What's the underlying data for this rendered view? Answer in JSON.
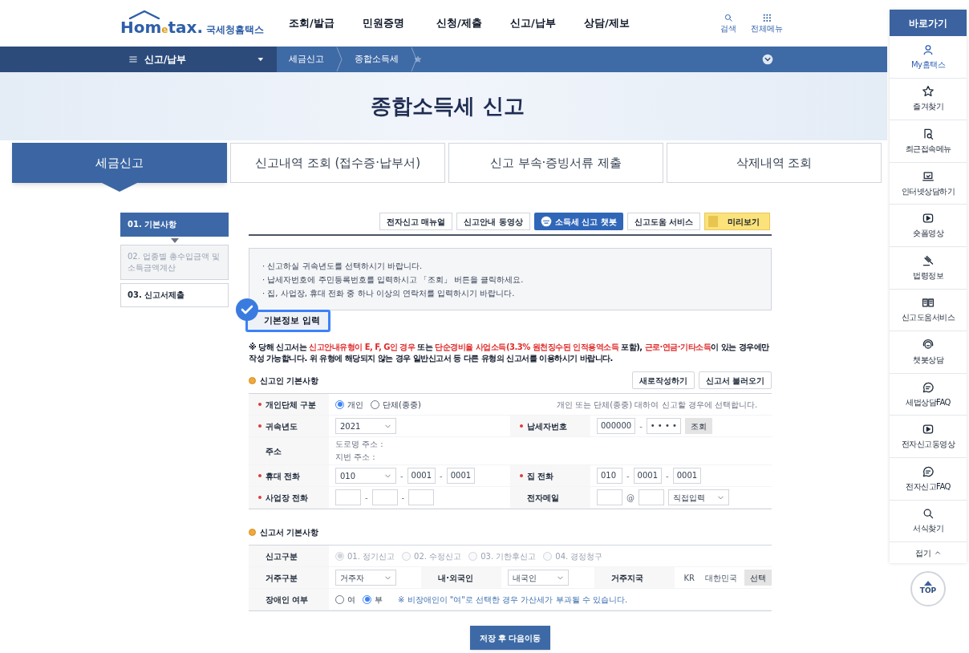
{
  "header": {
    "logo": {
      "parts": [
        "Hom",
        "e",
        "tax."
      ],
      "subtitle": "국세청홈택스"
    },
    "nav": [
      "조회/발급",
      "민원증명",
      "신청/제출",
      "신고/납부",
      "상담/제보"
    ],
    "tools": [
      {
        "label": "검색"
      },
      {
        "label": "전체메뉴"
      }
    ]
  },
  "breadcrumb": {
    "menu": "신고/납부",
    "items": [
      "세금신고",
      "종합소득세"
    ]
  },
  "page_title": "종합소득세 신고",
  "tabs": [
    {
      "label": "세금신고",
      "selected": true
    },
    {
      "label": "신고내역 조회 (접수증·납부서)",
      "selected": false
    },
    {
      "label": "신고 부속·증빙서류 제출",
      "selected": false
    },
    {
      "label": "삭제내역 조회",
      "selected": false
    }
  ],
  "steps": [
    {
      "label": "01. 기본사항",
      "selected": true,
      "disabled": false
    },
    {
      "label": "02. 업종별 총수입금액 및 소득금액계산",
      "selected": false,
      "disabled": true
    },
    {
      "label": "03. 신고서제출",
      "selected": false,
      "disabled": false
    }
  ],
  "toolbar": [
    {
      "label": "전자신고 매뉴얼",
      "kind": "plain"
    },
    {
      "label": "신고안내 동영상",
      "kind": "plain"
    },
    {
      "label": "소득세 신고 챗봇",
      "kind": "chatbot"
    },
    {
      "label": "신고도움 서비스",
      "kind": "plain"
    },
    {
      "label": "미리보기",
      "kind": "preview"
    }
  ],
  "notices": [
    "· 신고하실 귀속년도를 선택하시기 바랍니다.",
    "· 납세자번호에 주민등록번호를 입력하시고 「조회」 버튼을 클릭하세요.",
    "· 집, 사업장, 휴대 전화 중 하나 이상의 연락처를 입력하시기 바랍니다."
  ],
  "section_title": "기본정보 입력",
  "warning": [
    {
      "text": "※ 당해 신고서는 ",
      "kind": "plain"
    },
    {
      "text": "신고안내유형이 E, F, G인 경우",
      "kind": "emphasis"
    },
    {
      "text": " 또는 ",
      "kind": "plain"
    },
    {
      "text": "단순경비율 사업소득(3.3% 원천징수된 인적용역소득",
      "kind": "emphasis"
    },
    {
      "text": " 포함), ",
      "kind": "plain"
    },
    {
      "text": "근로·연금·기타소득",
      "kind": "emphasis"
    },
    {
      "text": "이 있는 경우에만 작성 가능합니다. 위 유형에 해당되지 않는 경우 일반신고서 등 다른 유형의 신고서를 이용하시기 바랍니다.",
      "kind": "plain"
    }
  ],
  "taxpayer": {
    "title": "신고인 기본사항",
    "buttons": [
      "새로작성하기",
      "신고서 불러오기"
    ],
    "rows": [
      {
        "cells": [
          {
            "kind": "label",
            "text": "개인단체 구분",
            "required": true
          },
          {
            "kind": "controls",
            "items": [
              {
                "kind": "radio",
                "label": "개인",
                "selected": true,
                "disabled": false
              },
              {
                "kind": "radio",
                "label": "단체(종중)",
                "selected": false,
                "disabled": false
              }
            ]
          },
          {
            "kind": "note",
            "text": "개인 또는 단체(종중) 대하여 신고할 경우에 선택합니다."
          }
        ]
      },
      {
        "cells": [
          {
            "kind": "label",
            "text": "귀속년도",
            "required": true
          },
          {
            "kind": "controls",
            "items": [
              {
                "kind": "select",
                "value": "2021"
              }
            ]
          },
          {
            "kind": "label",
            "text": "납세자번호",
            "required": true
          },
          {
            "kind": "controls",
            "items": [
              {
                "kind": "input",
                "value": "000000"
              },
              {
                "kind": "sep",
                "text": "-"
              },
              {
                "kind": "input",
                "value": "• • • •"
              },
              {
                "kind": "button",
                "label": "조회"
              }
            ]
          }
        ]
      },
      {
        "cells": [
          {
            "kind": "label",
            "text": "주소",
            "required": false
          },
          {
            "kind": "lines",
            "lines": [
              "도로명 주소 :",
              "지번 주소 :"
            ]
          }
        ]
      },
      {
        "cells": [
          {
            "kind": "label",
            "text": "휴대 전화",
            "required": true
          },
          {
            "kind": "controls",
            "items": [
              {
                "kind": "select",
                "value": "010"
              },
              {
                "kind": "sep",
                "text": "-"
              },
              {
                "kind": "input",
                "value": "0001"
              },
              {
                "kind": "sep",
                "text": "-"
              },
              {
                "kind": "input",
                "value": "0001"
              }
            ]
          },
          {
            "kind": "label",
            "text": "집 전화",
            "required": true
          },
          {
            "kind": "controls",
            "items": [
              {
                "kind": "input",
                "value": "010"
              },
              {
                "kind": "sep",
                "text": "-"
              },
              {
                "kind": "input",
                "value": "0001"
              },
              {
                "kind": "sep",
                "text": "-"
              },
              {
                "kind": "input",
                "value": "0001"
              }
            ]
          }
        ]
      },
      {
        "cells": [
          {
            "kind": "label",
            "text": "사업장 전화",
            "required": true
          },
          {
            "kind": "controls",
            "items": [
              {
                "kind": "input"
              },
              {
                "kind": "sep",
                "text": "-"
              },
              {
                "kind": "input"
              },
              {
                "kind": "sep",
                "text": "-"
              },
              {
                "kind": "input"
              }
            ]
          },
          {
            "kind": "label",
            "text": "전자메일",
            "required": false
          },
          {
            "kind": "controls",
            "items": [
              {
                "kind": "input"
              },
              {
                "kind": "sep",
                "text": "@"
              },
              {
                "kind": "input"
              },
              {
                "kind": "select",
                "value": "직접입력"
              }
            ]
          }
        ]
      }
    ]
  },
  "report": {
    "title": "신고서 기본사항",
    "rows": [
      {
        "cells": [
          {
            "kind": "label",
            "text": "신고구분",
            "required": false
          },
          {
            "kind": "controls",
            "items": [
              {
                "kind": "radio",
                "label": "01. 정기신고",
                "selected": true,
                "disabled": true
              },
              {
                "kind": "radio",
                "label": "02. 수정신고",
                "selected": false,
                "disabled": true
              },
              {
                "kind": "radio",
                "label": "03. 기한후신고",
                "selected": false,
                "disabled": true
              },
              {
                "kind": "radio",
                "label": "04. 경정청구",
                "selected": false,
                "disabled": true
              }
            ]
          }
        ]
      },
      {
        "cells": [
          {
            "kind": "label",
            "text": "거주구분",
            "required": false
          },
          {
            "kind": "controls",
            "items": [
              {
                "kind": "select",
                "value": "거주자"
              }
            ]
          },
          {
            "kind": "label",
            "text": "내·외국인",
            "required": false
          },
          {
            "kind": "controls",
            "items": [
              {
                "kind": "select",
                "value": "내국인"
              }
            ]
          },
          {
            "kind": "label",
            "text": "거주지국",
            "required": false
          },
          {
            "kind": "controls",
            "items": [
              {
                "kind": "text",
                "text": "KR"
              },
              {
                "kind": "text",
                "text": "대한민국"
              },
              {
                "kind": "button",
                "label": "선택"
              }
            ]
          }
        ]
      },
      {
        "cells": [
          {
            "kind": "label",
            "text": "장애인 여부",
            "required": false
          },
          {
            "kind": "controls",
            "items": [
              {
                "kind": "radio",
                "label": "여",
                "selected": false,
                "disabled": false
              },
              {
                "kind": "radio",
                "label": "부",
                "selected": true,
                "disabled": false
              },
              {
                "kind": "hint",
                "text": "※ 비장애인이 \"여\"로 선택한 경우 가산세가 부과될 수 있습니다."
              }
            ]
          }
        ]
      }
    ]
  },
  "save_button": "저장 후 다음이동",
  "sidebar": {
    "title": "바로가기",
    "items": [
      {
        "label": "My홈택스",
        "selected": true
      },
      {
        "label": "즐겨찾기",
        "selected": false
      },
      {
        "label": "최근접속메뉴",
        "selected": false
      },
      {
        "label": "인터넷상담하기",
        "selected": false
      },
      {
        "label": "숏폼영상",
        "selected": false
      },
      {
        "label": "법령정보",
        "selected": false
      },
      {
        "label": "신고도움서비스",
        "selected": false
      },
      {
        "label": "챗봇상담",
        "selected": false
      },
      {
        "label": "세법상담FAQ",
        "selected": false
      },
      {
        "label": "전자신고동영상",
        "selected": false
      },
      {
        "label": "전자신고FAQ",
        "selected": false
      },
      {
        "label": "서식찾기",
        "selected": false
      }
    ],
    "fold": "접기",
    "top": "TOP"
  }
}
